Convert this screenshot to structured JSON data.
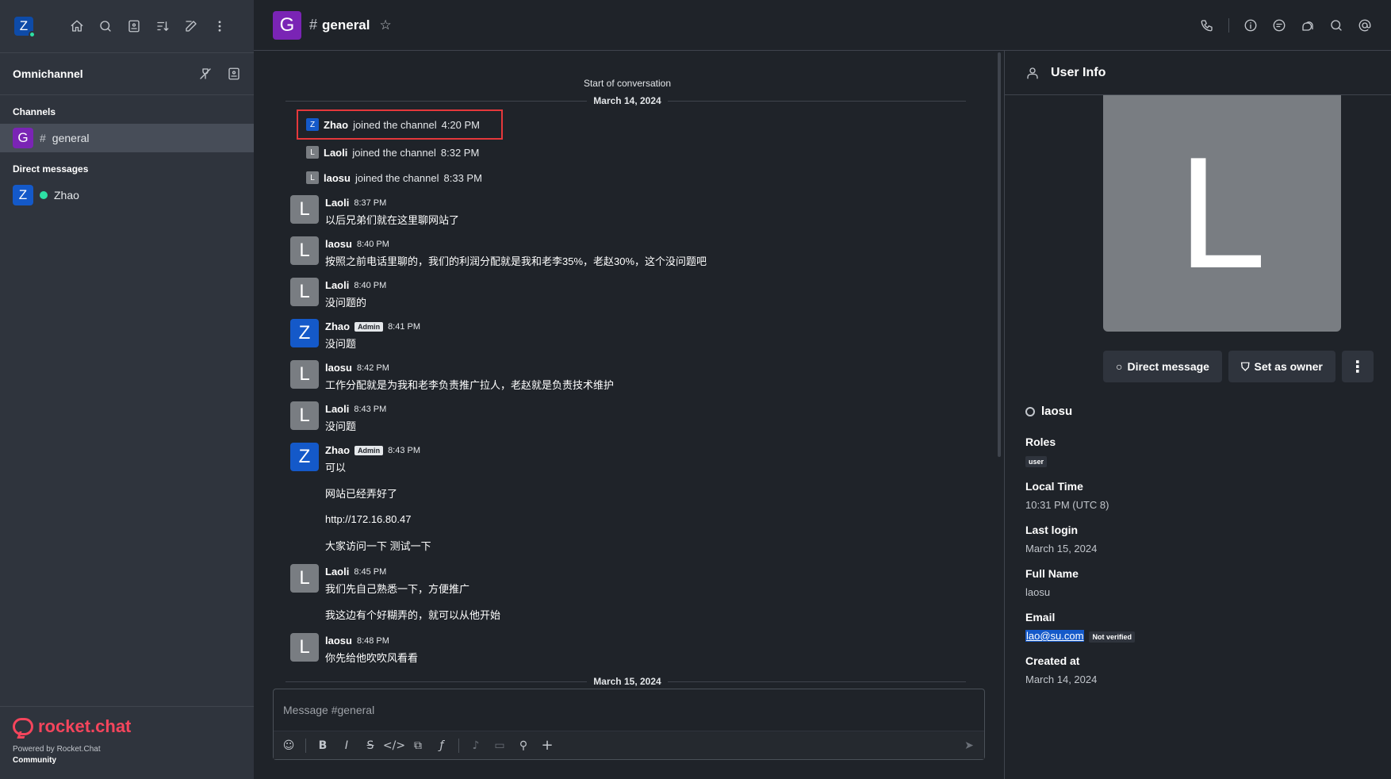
{
  "sidebar": {
    "user_initial": "Z",
    "section_title": "Omnichannel",
    "channels_label": "Channels",
    "channels": [
      {
        "initial": "G",
        "name": "general"
      }
    ],
    "dm_label": "Direct messages",
    "dms": [
      {
        "initial": "Z",
        "name": "Zhao"
      }
    ],
    "footer": {
      "brand": "rocket.chat",
      "powered": "Powered by Rocket.Chat",
      "edition": "Community"
    }
  },
  "header": {
    "room_initial": "G",
    "room_name": "general"
  },
  "messages": {
    "start": "Start of conversation",
    "date1": "March 14, 2024",
    "system": [
      {
        "initial": "Z",
        "user": "Zhao",
        "text": "joined the channel",
        "time": "4:20 PM"
      },
      {
        "initial": "L",
        "user": "Laoli",
        "text": "joined the channel",
        "time": "8:32 PM"
      },
      {
        "initial": "L",
        "user": "laosu",
        "text": "joined the channel",
        "time": "8:33 PM"
      }
    ],
    "items": [
      {
        "initial": "L",
        "user": "Laoli",
        "time": "8:37 PM",
        "text": "以后兄弟们就在这里聊网站了"
      },
      {
        "initial": "L",
        "user": "laosu",
        "time": "8:40 PM",
        "text": "按照之前电话里聊的，我们的利润分配就是我和老李35%，老赵30%，这个没问题吧"
      },
      {
        "initial": "L",
        "user": "Laoli",
        "time": "8:40 PM",
        "text": "没问题的"
      },
      {
        "initial": "Z",
        "user": "Zhao",
        "badge": "Admin",
        "time": "8:41 PM",
        "text": "没问题"
      },
      {
        "initial": "L",
        "user": "laosu",
        "time": "8:42 PM",
        "text": "工作分配就是为我和老李负责推广拉人，老赵就是负责技术维护"
      },
      {
        "initial": "L",
        "user": "Laoli",
        "time": "8:43 PM",
        "text": "没问题"
      },
      {
        "initial": "Z",
        "user": "Zhao",
        "badge": "Admin",
        "time": "8:43 PM",
        "text": "可以"
      },
      {
        "initial": "L",
        "user": "Laoli",
        "time": "8:45 PM",
        "text": "我们先自己熟悉一下，方便推广"
      },
      {
        "initial": "L",
        "user": "laosu",
        "time": "8:48 PM",
        "text": "你先给他吹吹风看看"
      }
    ],
    "zhao_cont": [
      "网站已经弄好了",
      "http://172.16.80.47",
      "大家访问一下 测试一下"
    ],
    "laoli_cont": [
      "我这边有个好糊弄的，就可以从他开始"
    ],
    "date2": "March 15, 2024"
  },
  "composer": {
    "placeholder": "Message #general"
  },
  "panel": {
    "title": "User Info",
    "avatar_initial": "L",
    "btn_dm": "Direct message",
    "btn_owner": "Set as owner",
    "username": "laosu",
    "roles_label": "Roles",
    "role": "user",
    "local_time_label": "Local Time",
    "local_time": "10:31 PM (UTC 8)",
    "last_login_label": "Last login",
    "last_login": "March 15, 2024",
    "full_name_label": "Full Name",
    "full_name": "laosu",
    "email_label": "Email",
    "email": "lao@su.com",
    "email_status": "Not verified",
    "created_label": "Created at",
    "created": "March 14, 2024"
  },
  "colors": {
    "accent": "#1459c9",
    "highlight": "#e5383b",
    "online": "#2de0a5",
    "brand": "#f5455c"
  }
}
